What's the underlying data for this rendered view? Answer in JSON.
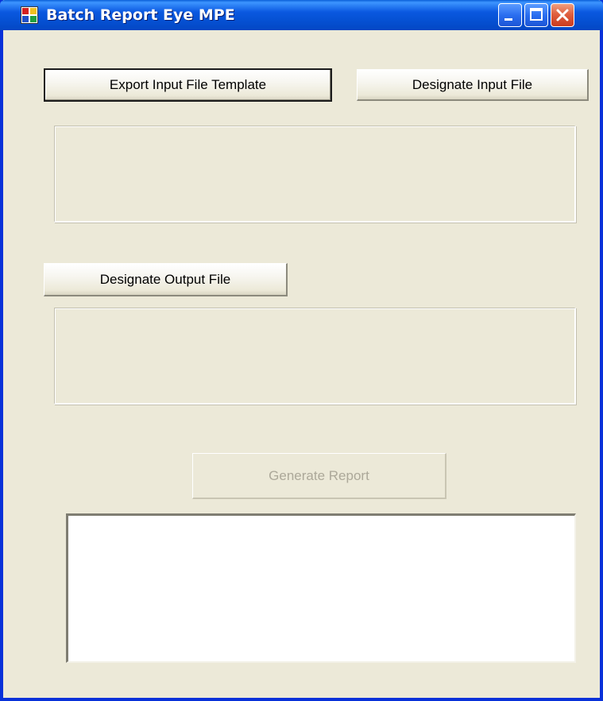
{
  "window": {
    "title": "Batch Report Eye MPE",
    "icon": "app-window-icon",
    "controls": {
      "minimize": "minimize-icon",
      "maximize": "maximize-icon",
      "close": "close-icon"
    }
  },
  "buttons": {
    "export_template": "Export Input File Template",
    "designate_input": "Designate Input File",
    "designate_output": "Designate Output File",
    "generate_report": "Generate Report"
  },
  "input_file_display": "",
  "output_file_display": "",
  "report_log": "",
  "colors": {
    "titlebar": "#0553d4",
    "frame_border": "#0831d9",
    "window_face": "#ece9d8",
    "close_button": "#d8502e",
    "disabled_text": "#aca899"
  }
}
